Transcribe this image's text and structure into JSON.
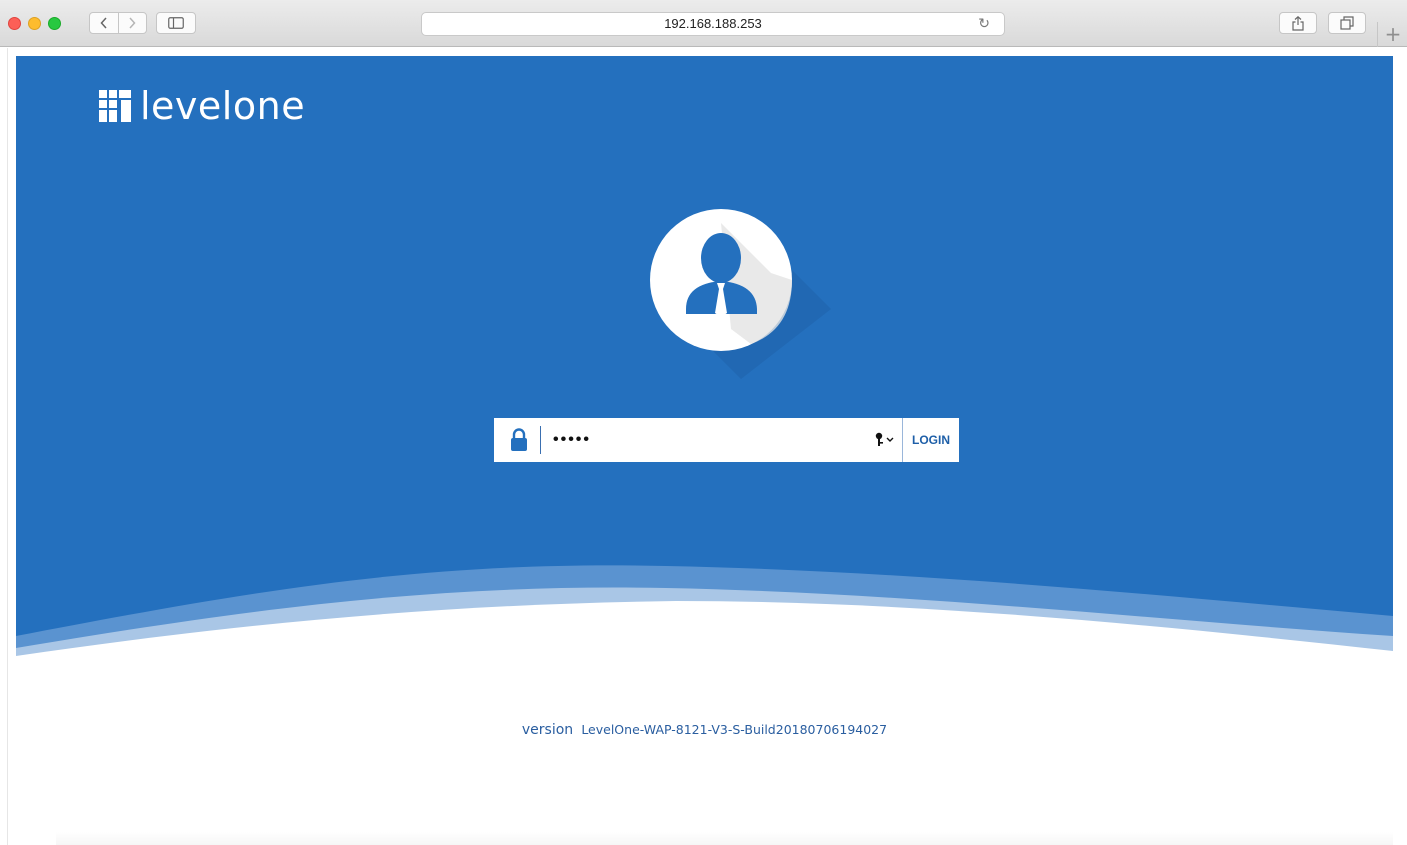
{
  "browser": {
    "url": "192.168.188.253",
    "new_tab_symbol": "+",
    "reload_symbol": "↻"
  },
  "brand": {
    "logo_text": "levelone",
    "primary_color": "#2470be",
    "wave_light": "#a9c6e6"
  },
  "login": {
    "password_value": "•••••",
    "password_type": "password",
    "login_label": "LOGIN"
  },
  "footer": {
    "version_label": "version",
    "version_value": "LevelOne-WAP-8121-V3-S-Build20180706194027"
  }
}
